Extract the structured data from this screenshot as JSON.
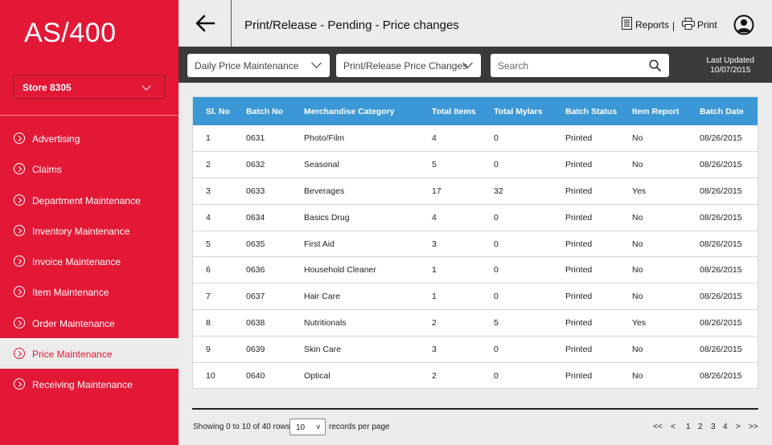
{
  "app": {
    "brand": "AS/400",
    "store": "Store 8305"
  },
  "sidebar": {
    "items": [
      {
        "label": "Advertising",
        "active": false
      },
      {
        "label": "Claims",
        "active": false
      },
      {
        "label": "Department Maintenance",
        "active": false
      },
      {
        "label": "Inventory Maintenance",
        "active": false
      },
      {
        "label": "Invoice Maintenance",
        "active": false
      },
      {
        "label": "Item Maintenance",
        "active": false
      },
      {
        "label": "Order Maintenance",
        "active": false
      },
      {
        "label": "Price Maintenance",
        "active": true
      },
      {
        "label": "Receiving Maintenance",
        "active": false
      }
    ]
  },
  "header": {
    "title": "Print/Release - Pending - Price changes",
    "reports_label": "Reports",
    "separator": "|",
    "print_label": "Print"
  },
  "filters": {
    "dropdown1": "Daily Price Maintenance",
    "dropdown2": "Print/Release Price Changes",
    "search_placeholder": "Search",
    "last_updated_label": "Last Updated",
    "last_updated_date": "10/07/2015"
  },
  "table": {
    "columns": [
      "Sl. No",
      "Batch No",
      "Merchandise Category",
      "Total Items",
      "Total Mylars",
      "Batch Status",
      "Item Report",
      "Batch Date"
    ],
    "rows": [
      [
        "1",
        "0631",
        "Photo/Film",
        "4",
        "0",
        "Printed",
        "No",
        "08/26/2015"
      ],
      [
        "2",
        "0632",
        "Seasonal",
        "5",
        "0",
        "Printed",
        "No",
        "08/26/2015"
      ],
      [
        "3",
        "0633",
        "Beverages",
        "17",
        "32",
        "Printed",
        "Yes",
        "08/26/2015"
      ],
      [
        "4",
        "0634",
        "Basics Drug",
        "4",
        "0",
        "Printed",
        "No",
        "08/26/2015"
      ],
      [
        "5",
        "0635",
        "First Aid",
        "3",
        "0",
        "Printed",
        "No",
        "08/26/2015"
      ],
      [
        "6",
        "0636",
        "Household Cleaner",
        "1",
        "0",
        "Printed",
        "No",
        "08/26/2015"
      ],
      [
        "7",
        "0637",
        "Hair Care",
        "1",
        "0",
        "Printed",
        "No",
        "08/26/2015"
      ],
      [
        "8",
        "0638",
        "Nutritionals",
        "2",
        "5",
        "Printed",
        "Yes",
        "08/26/2015"
      ],
      [
        "9",
        "0639",
        "Skin Care",
        "3",
        "0",
        "Printed",
        "No",
        "08/26/2015"
      ],
      [
        "10",
        "0640",
        "Optical",
        "2",
        "0",
        "Printed",
        "No",
        "08/26/2015"
      ]
    ]
  },
  "footer": {
    "showing": "Showing 0 to 10 of 40 rows",
    "rows_value": "10",
    "rows_arrow": "v",
    "records_per_page": "records per page",
    "pager": [
      "<<",
      "<",
      "1",
      "2",
      "3",
      "4",
      ">",
      ">>"
    ]
  },
  "colors": {
    "brand_red": "#e31837",
    "table_header_blue": "#3b97d6",
    "filter_bar": "#3a3a3a"
  }
}
